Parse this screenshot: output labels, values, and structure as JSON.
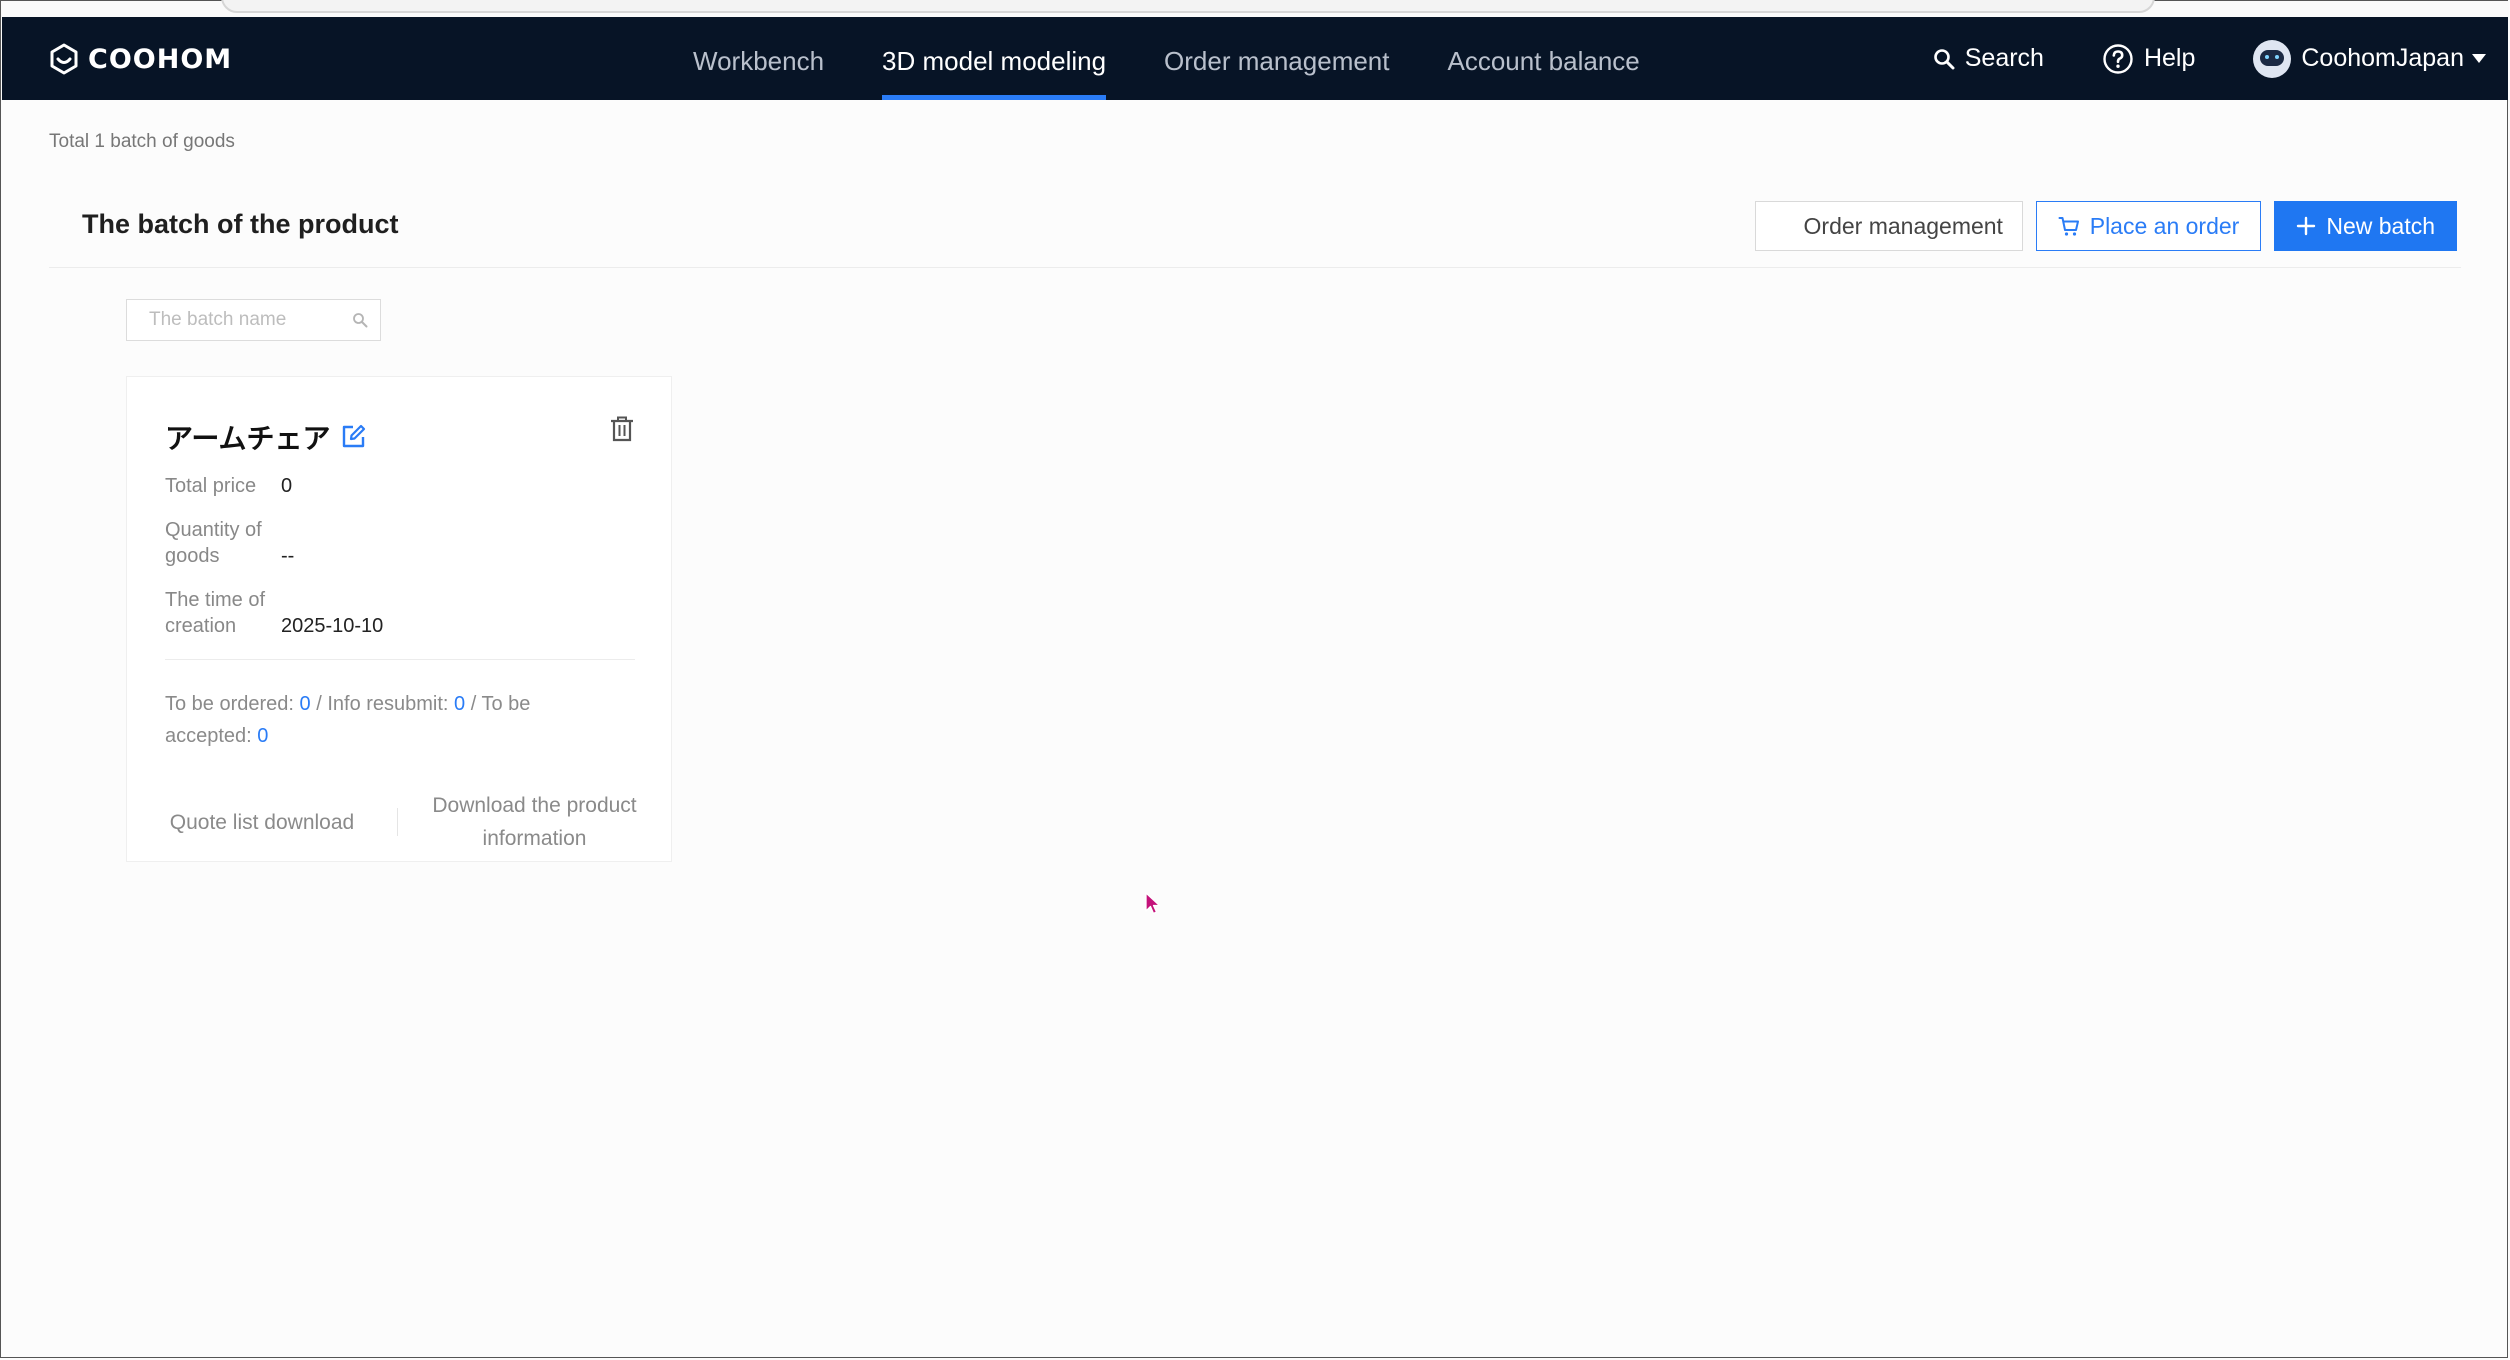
{
  "navbar": {
    "logo_text": "COOHOM",
    "links": [
      {
        "label": "Workbench",
        "active": false
      },
      {
        "label": "3D model modeling",
        "active": true
      },
      {
        "label": "Order management",
        "active": false
      },
      {
        "label": "Account balance",
        "active": false
      }
    ],
    "search_label": "Search",
    "help_label": "Help",
    "user_name": "CoohomJapan"
  },
  "breadcrumb": "Total 1 batch of goods",
  "header": {
    "title": "The batch of the product",
    "order_management_label": "Order management",
    "place_order_label": "Place an order",
    "new_batch_label": "New batch"
  },
  "search": {
    "placeholder": "The batch name",
    "value": ""
  },
  "batch_card": {
    "name": "アームチェア",
    "total_price_label": "Total price",
    "total_price_value": "0",
    "quantity_label": "Quantity of goods",
    "quantity_value": "--",
    "created_label": "The time of creation",
    "created_value": "2025-10-10",
    "status": {
      "to_be_ordered_label": "To be ordered: ",
      "to_be_ordered_value": "0",
      "info_resubmit_label": " / Info resubmit: ",
      "info_resubmit_value": "0",
      "to_be_accepted_label": " / To be accepted: ",
      "to_be_accepted_value": "0"
    },
    "quote_download_label": "Quote list download",
    "product_info_download_label": "Download the product information"
  },
  "colors": {
    "navbar_bg": "#071426",
    "accent": "#1f77f2",
    "link_blue": "#2a7cf6"
  },
  "icons": [
    "coohom-logo-icon",
    "search-icon",
    "help-icon",
    "avatar",
    "caret-down-icon",
    "cart-icon",
    "plus-icon",
    "edit-icon",
    "trash-icon",
    "mouse-cursor-icon"
  ]
}
